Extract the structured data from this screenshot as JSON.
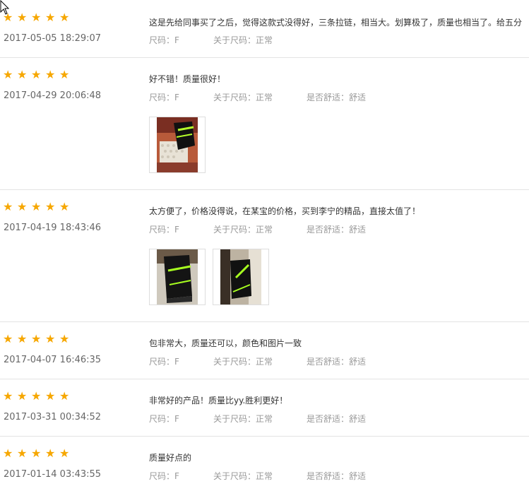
{
  "reviews": [
    {
      "stars": 5,
      "date": "2017-05-05 18:29:07",
      "content": "这是先给同事买了之后，觉得这款式没得好，三条拉链，相当大。划算极了，质量也相当了。给五分",
      "size": "尺码：F",
      "fit": "关于尺码：正常",
      "comfort": ""
    },
    {
      "stars": 5,
      "date": "2017-04-29 20:06:48",
      "content": "好不错！质量很好！",
      "size": "尺码：F",
      "fit": "关于尺码：正常",
      "comfort": "是否舒适：舒适",
      "photos": 1
    },
    {
      "stars": 5,
      "date": "2017-04-19 18:43:46",
      "content": "太方便了，价格没得说，在某宝的价格，买到李宁的精品，直接太值了！",
      "size": "尺码：F",
      "fit": "关于尺码：正常",
      "comfort": "是否舒适：舒适",
      "photos": 2
    },
    {
      "stars": 5,
      "date": "2017-04-07 16:46:35",
      "content": "包非常大，质量还可以，颜色和图片一致",
      "size": "尺码：F",
      "fit": "关于尺码：正常",
      "comfort": "是否舒适：舒适"
    },
    {
      "stars": 5,
      "date": "2017-03-31 00:34:52",
      "content": "非常好的产品！质量比yy.胜利更好！",
      "size": "尺码：F",
      "fit": "关于尺码：正常",
      "comfort": "是否舒适：舒适"
    },
    {
      "stars": 5,
      "date": "2017-01-14 03:43:55",
      "content": "质量好点的",
      "size": "尺码：F",
      "fit": "关于尺码：正常",
      "comfort": "是否舒适：舒适"
    }
  ],
  "colors": {
    "star": "#f6a700",
    "divider": "#e3e3e3",
    "meta": "#999999"
  },
  "icons": {
    "star": "star-icon",
    "cursor": "mouse-pointer-icon",
    "photo": "review-photo-thumbnail"
  }
}
